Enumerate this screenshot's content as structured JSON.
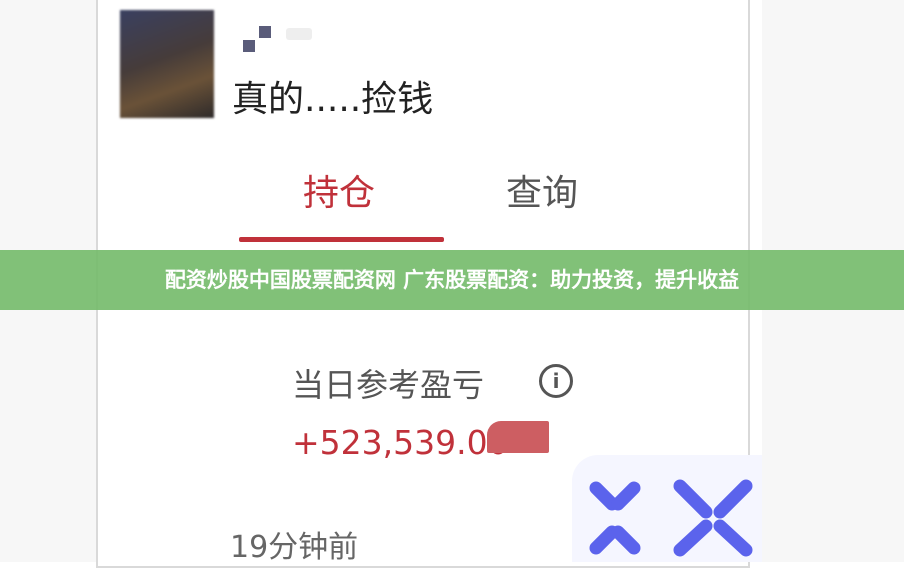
{
  "post": {
    "username": "真的.....捡钱"
  },
  "tabs": [
    {
      "label": "持仓",
      "active": true
    },
    {
      "label": "查询",
      "active": false
    }
  ],
  "banner": {
    "text": "配资炒股中国股票配资网 广东股票配资：助力投资，提升收益"
  },
  "profit": {
    "label": "当日参考盈亏",
    "info_icon": "info-icon",
    "value": "+523,539.00"
  },
  "timestamp": "19分钟前",
  "colors": {
    "accent": "#c0313a",
    "banner": "#76bc6c",
    "logo": "#5b63ec"
  }
}
